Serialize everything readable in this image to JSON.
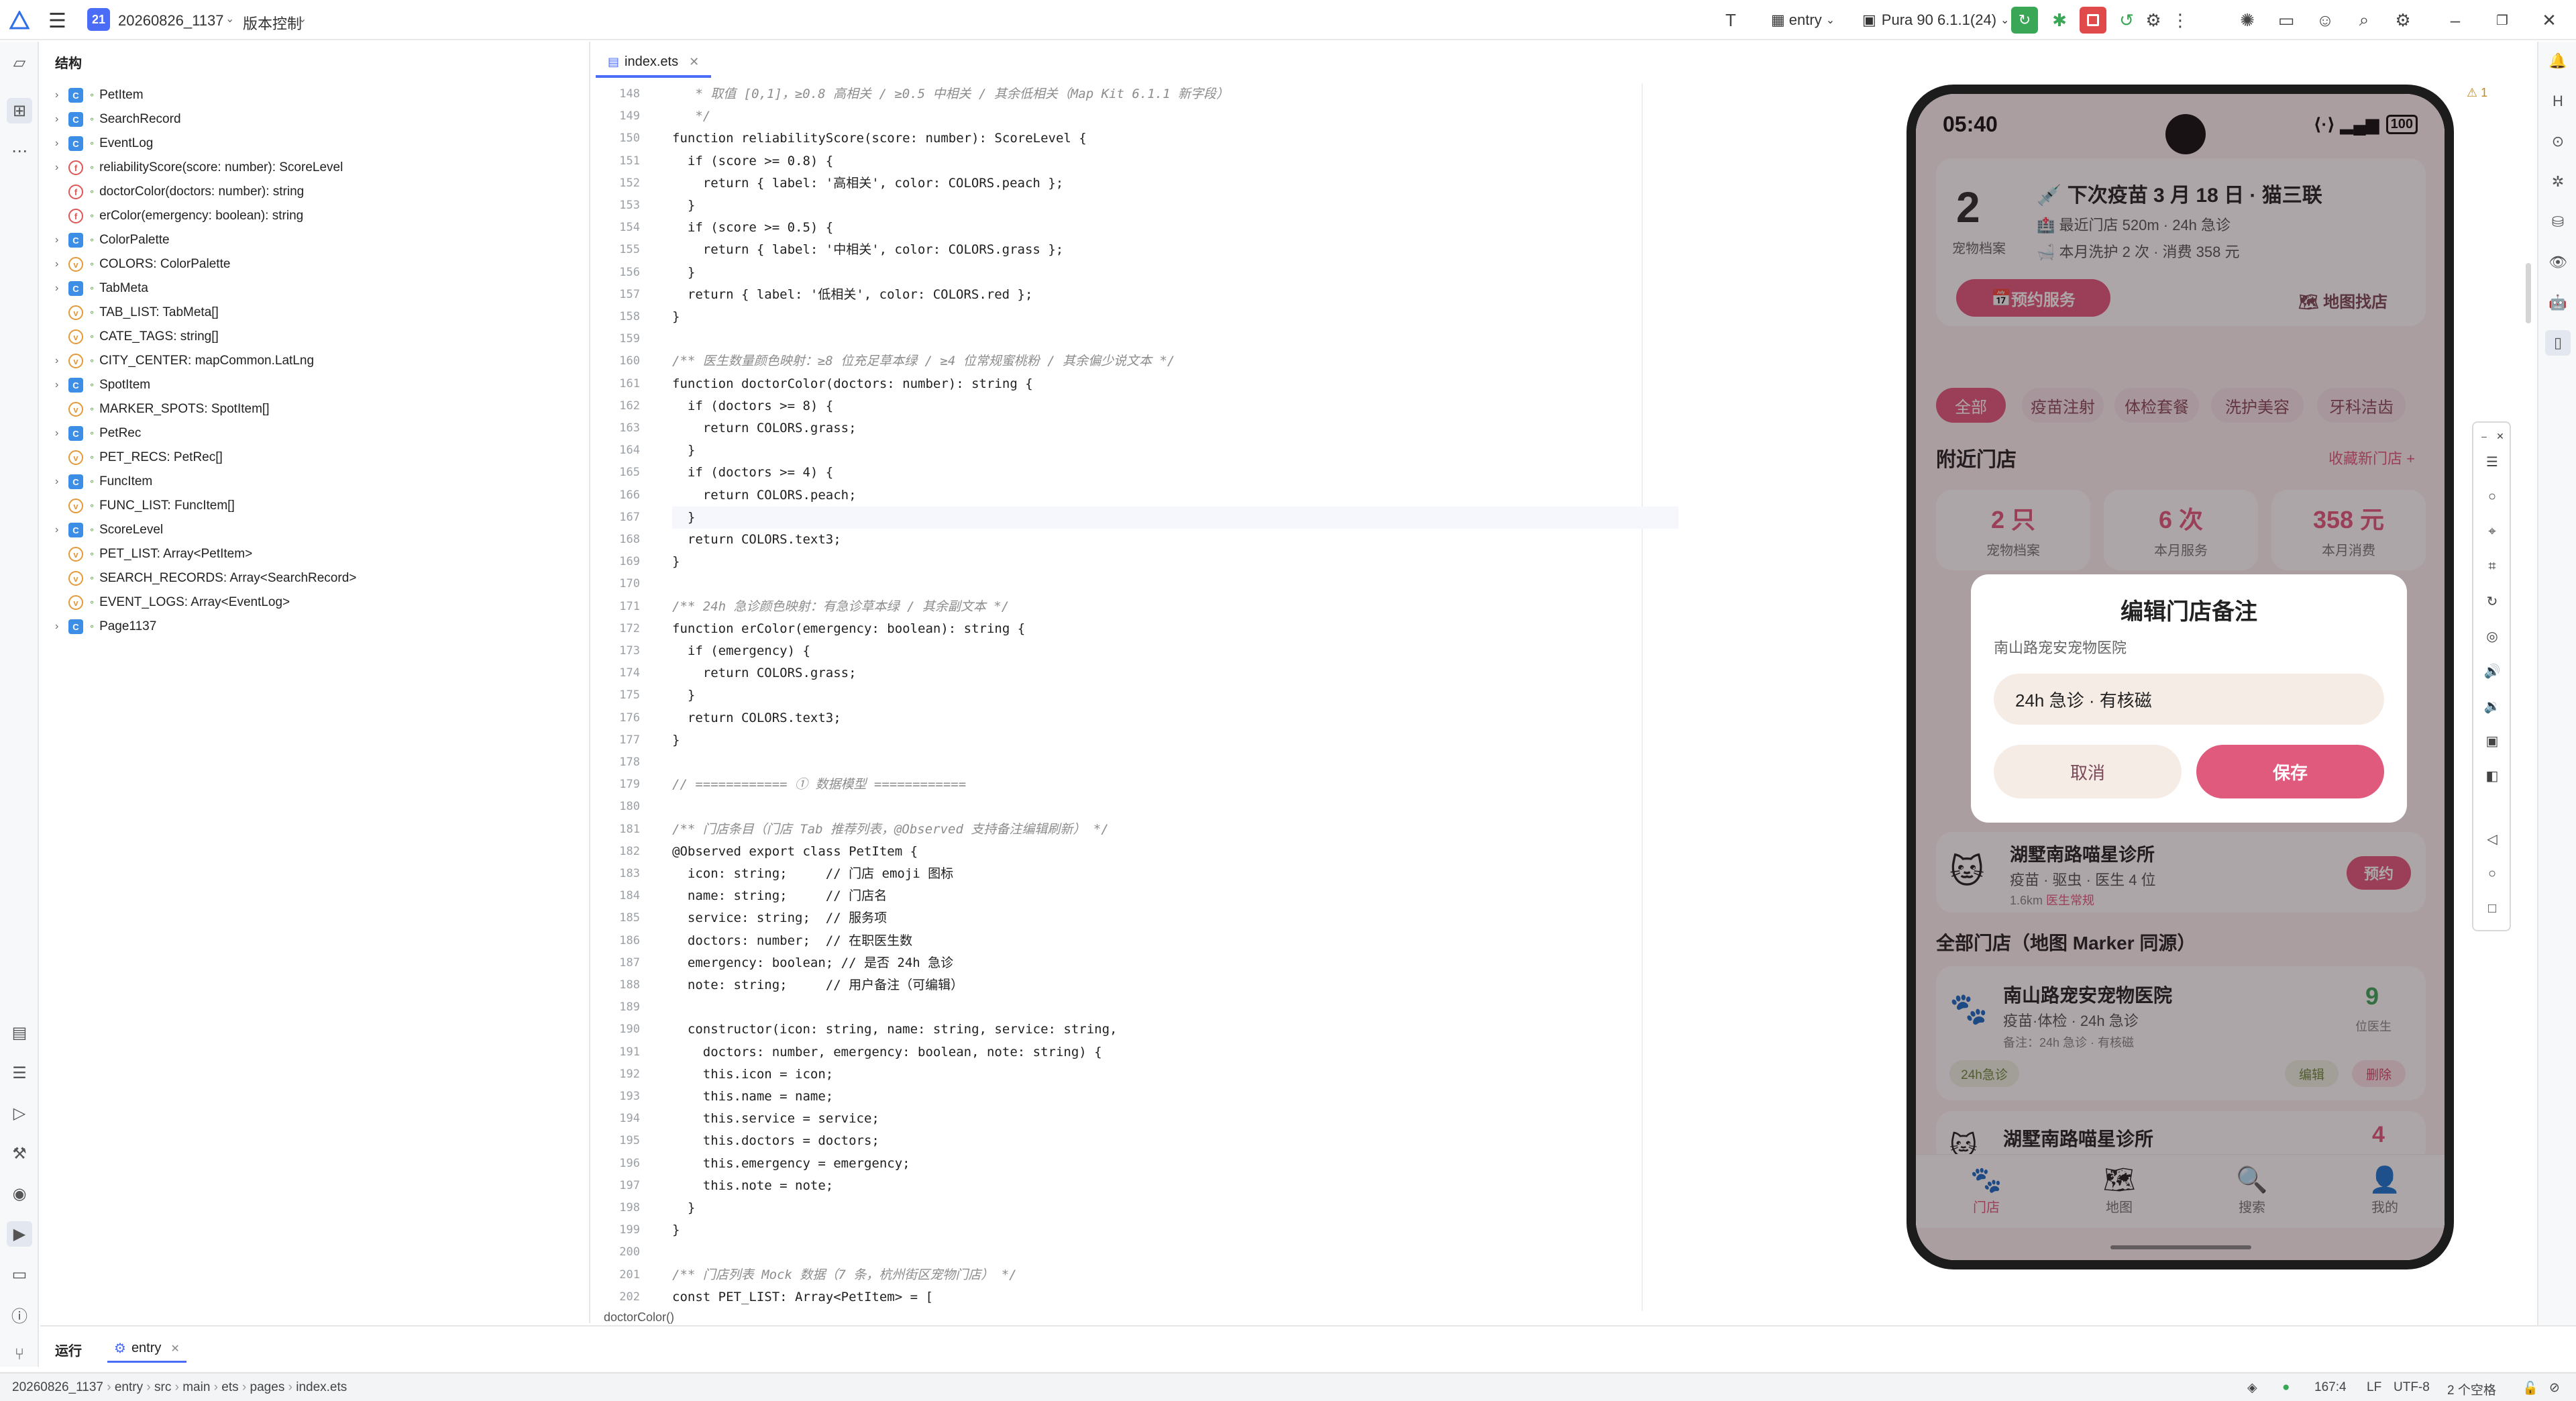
{
  "titlebar": {
    "project_badge": "21",
    "project_name": "20260826_1137",
    "vcs": "版本控制",
    "entry": "entry",
    "device": "Pura 90 6.1.1(24)"
  },
  "colors": {
    "accent": "#4a6cf7",
    "run_green": "#3aa757",
    "stop_red": "#e04a4a",
    "app_pink": "#e05a7d",
    "app_bg": "#fbf3f4"
  },
  "structure": {
    "title": "结构",
    "items": [
      {
        "kind": "class",
        "label": "PetItem",
        "expand": true
      },
      {
        "kind": "class",
        "label": "SearchRecord",
        "expand": true
      },
      {
        "kind": "class",
        "label": "EventLog",
        "expand": true
      },
      {
        "kind": "func",
        "label": "reliabilityScore(score: number): ScoreLevel",
        "expand": true
      },
      {
        "kind": "func",
        "label": "doctorColor(doctors: number): string",
        "expand": false
      },
      {
        "kind": "func",
        "label": "erColor(emergency: boolean): string",
        "expand": false
      },
      {
        "kind": "class",
        "label": "ColorPalette",
        "expand": true
      },
      {
        "kind": "var",
        "label": "COLORS: ColorPalette",
        "expand": true
      },
      {
        "kind": "class",
        "label": "TabMeta",
        "expand": true
      },
      {
        "kind": "var",
        "label": "TAB_LIST: TabMeta[]",
        "expand": false
      },
      {
        "kind": "var",
        "label": "CATE_TAGS: string[]",
        "expand": false
      },
      {
        "kind": "var",
        "label": "CITY_CENTER: mapCommon.LatLng",
        "expand": true
      },
      {
        "kind": "class",
        "label": "SpotItem",
        "expand": true
      },
      {
        "kind": "var",
        "label": "MARKER_SPOTS: SpotItem[]",
        "expand": false
      },
      {
        "kind": "class",
        "label": "PetRec",
        "expand": true
      },
      {
        "kind": "var",
        "label": "PET_RECS: PetRec[]",
        "expand": false
      },
      {
        "kind": "class",
        "label": "FuncItem",
        "expand": true
      },
      {
        "kind": "var",
        "label": "FUNC_LIST: FuncItem[]",
        "expand": false
      },
      {
        "kind": "class",
        "label": "ScoreLevel",
        "expand": true
      },
      {
        "kind": "var",
        "label": "PET_LIST: Array<PetItem>",
        "expand": false
      },
      {
        "kind": "var",
        "label": "SEARCH_RECORDS: Array<SearchRecord>",
        "expand": false
      },
      {
        "kind": "var",
        "label": "EVENT_LOGS: Array<EventLog>",
        "expand": false
      },
      {
        "kind": "class",
        "label": "Page1137",
        "expand": true
      }
    ]
  },
  "editor": {
    "tab": "index.ets",
    "breadcrumb": "doctorColor()",
    "warning_count": "1",
    "lines": [
      {
        "n": "148",
        "t": "   * 取值 [0,1]，≥0.8 高相关 / ≥0.5 中相关 / 其余低相关（Map Kit 6.1.1 新字段）"
      },
      {
        "n": "149",
        "t": "   */"
      },
      {
        "n": "150",
        "t": "function reliabilityScore(score: number): ScoreLevel {"
      },
      {
        "n": "151",
        "t": "  if (score >= 0.8) {"
      },
      {
        "n": "152",
        "t": "    return { label: '高相关', color: COLORS.peach };"
      },
      {
        "n": "153",
        "t": "  }"
      },
      {
        "n": "154",
        "t": "  if (score >= 0.5) {"
      },
      {
        "n": "155",
        "t": "    return { label: '中相关', color: COLORS.grass };"
      },
      {
        "n": "156",
        "t": "  }"
      },
      {
        "n": "157",
        "t": "  return { label: '低相关', color: COLORS.red };"
      },
      {
        "n": "158",
        "t": "}"
      },
      {
        "n": "159",
        "t": ""
      },
      {
        "n": "160",
        "t": "/** 医生数量颜色映射：≥8 位充足草本绿 / ≥4 位常规蜜桃粉 / 其余偏少说文本 */"
      },
      {
        "n": "161",
        "t": "function doctorColor(doctors: number): string {"
      },
      {
        "n": "162",
        "t": "  if (doctors >= 8) {"
      },
      {
        "n": "163",
        "t": "    return COLORS.grass;"
      },
      {
        "n": "164",
        "t": "  }"
      },
      {
        "n": "165",
        "t": "  if (doctors >= 4) {"
      },
      {
        "n": "166",
        "t": "    return COLORS.peach;"
      },
      {
        "n": "167",
        "t": "  }"
      },
      {
        "n": "168",
        "t": "  return COLORS.text3;"
      },
      {
        "n": "169",
        "t": "}"
      },
      {
        "n": "170",
        "t": ""
      },
      {
        "n": "171",
        "t": "/** 24h 急诊颜色映射：有急诊草本绿 / 其余副文本 */"
      },
      {
        "n": "172",
        "t": "function erColor(emergency: boolean): string {"
      },
      {
        "n": "173",
        "t": "  if (emergency) {"
      },
      {
        "n": "174",
        "t": "    return COLORS.grass;"
      },
      {
        "n": "175",
        "t": "  }"
      },
      {
        "n": "176",
        "t": "  return COLORS.text3;"
      },
      {
        "n": "177",
        "t": "}"
      },
      {
        "n": "178",
        "t": ""
      },
      {
        "n": "179",
        "t": "// ============ ① 数据模型 ============"
      },
      {
        "n": "180",
        "t": ""
      },
      {
        "n": "181",
        "t": "/** 门店条目（门店 Tab 推荐列表，@Observed 支持备注编辑刷新） */"
      },
      {
        "n": "182",
        "t": "@Observed export class PetItem {"
      },
      {
        "n": "183",
        "t": "  icon: string;     // 门店 emoji 图标"
      },
      {
        "n": "184",
        "t": "  name: string;     // 门店名"
      },
      {
        "n": "185",
        "t": "  service: string;  // 服务项"
      },
      {
        "n": "186",
        "t": "  doctors: number;  // 在职医生数"
      },
      {
        "n": "187",
        "t": "  emergency: boolean; // 是否 24h 急诊"
      },
      {
        "n": "188",
        "t": "  note: string;     // 用户备注（可编辑）"
      },
      {
        "n": "189",
        "t": ""
      },
      {
        "n": "190",
        "t": "  constructor(icon: string, name: string, service: string,"
      },
      {
        "n": "191",
        "t": "    doctors: number, emergency: boolean, note: string) {"
      },
      {
        "n": "192",
        "t": "    this.icon = icon;"
      },
      {
        "n": "193",
        "t": "    this.name = name;"
      },
      {
        "n": "194",
        "t": "    this.service = service;"
      },
      {
        "n": "195",
        "t": "    this.doctors = doctors;"
      },
      {
        "n": "196",
        "t": "    this.emergency = emergency;"
      },
      {
        "n": "197",
        "t": "    this.note = note;"
      },
      {
        "n": "198",
        "t": "  }"
      },
      {
        "n": "199",
        "t": "}"
      },
      {
        "n": "200",
        "t": ""
      },
      {
        "n": "201",
        "t": "/** 门店列表 Mock 数据（7 条，杭州街区宠物门店） */"
      },
      {
        "n": "202",
        "t": "const PET_LIST: Array<PetItem> = ["
      }
    ]
  },
  "bottom": {
    "run_label": "运行",
    "tab": "entry"
  },
  "statusbar": {
    "path": [
      "20260826_1137",
      "entry",
      "src",
      "main",
      "ets",
      "pages",
      "index.ets"
    ],
    "position": "167:4",
    "line_ending": "LF",
    "encoding": "UTF-8",
    "indent": "2 个空格"
  },
  "phone": {
    "time": "05:40",
    "battery": "100",
    "header": {
      "pet_count": "2",
      "pet_count_label": "宠物档案",
      "next_vaccine": "下次疫苗 3 月 18 日 · 猫三联",
      "nearest": "最近门店 520m · 24h 急诊",
      "wash": "本月洗护 2 次 · 消费 358 元",
      "book_btn": "预约服务",
      "map_btn": "地图找店"
    },
    "chips": [
      "全部",
      "疫苗注射",
      "体检套餐",
      "洗护美容",
      "牙科洁齿"
    ],
    "nearby_title": "附近门店",
    "nearby_more": "收藏新门店 +",
    "stats": [
      {
        "value": "2 只",
        "label": "宠物档案"
      },
      {
        "value": "6 次",
        "label": "本月服务"
      },
      {
        "value": "358 元",
        "label": "本月消费"
      }
    ],
    "shop_partial": {
      "name": "湖墅南路喵星诊所",
      "desc": "疫苗 · 驱虫 · 医生 4 位",
      "dist": "1.6km",
      "tag": "医生常规",
      "btn": "预约"
    },
    "all_title": "全部门店（地图 Marker 同源）",
    "shop1": {
      "name": "南山路宠安宠物医院",
      "desc": "疫苗·体检 · 24h 急诊",
      "note": "备注：24h 急诊 · 有核磁",
      "doctors": "9",
      "doctors_label": "位医生",
      "tag": "24h急诊",
      "edit": "编辑",
      "delete": "删除"
    },
    "shop2": {
      "name": "湖墅南路喵星诊所",
      "doctors": "4"
    },
    "nav": [
      "门店",
      "地图",
      "搜索",
      "我的"
    ],
    "dialog": {
      "title": "编辑门店备注",
      "subtitle": "南山路宠安宠物医院",
      "input_value": "24h 急诊 · 有核磁",
      "cancel": "取消",
      "save": "保存"
    }
  }
}
